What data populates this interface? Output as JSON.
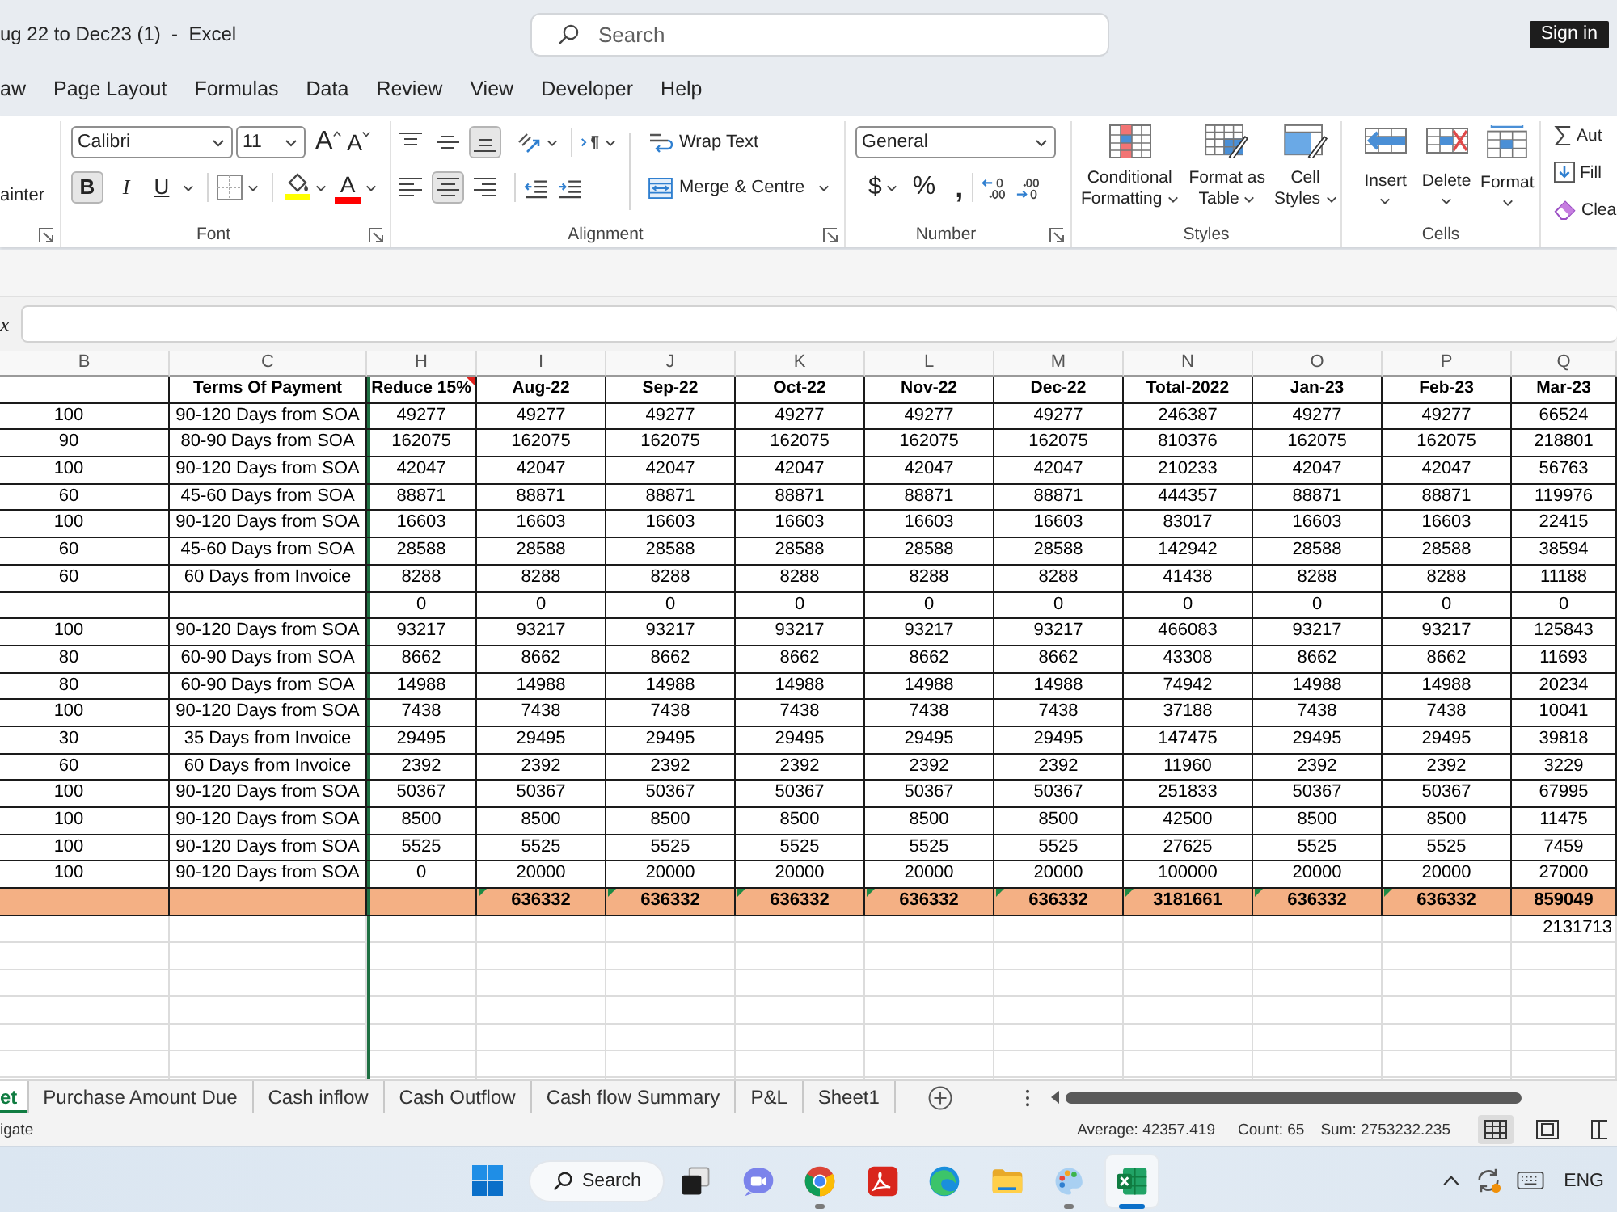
{
  "window": {
    "title": "ug 22 to Dec23 (1)  -  Excel",
    "search_placeholder": "Search",
    "sign_in": "Sign in"
  },
  "menu": [
    {
      "label": "aw",
      "selected": false
    },
    {
      "label": "Page Layout",
      "selected": false
    },
    {
      "label": "Formulas",
      "selected": false
    },
    {
      "label": "Data",
      "selected": false
    },
    {
      "label": "Review",
      "selected": false
    },
    {
      "label": "View",
      "selected": false
    },
    {
      "label": "Developer",
      "selected": false
    },
    {
      "label": "Help",
      "selected": false
    }
  ],
  "ribbon": {
    "clipboard": {
      "label": "ainter"
    },
    "font": {
      "title": "Font",
      "name": "Calibri",
      "size": "11",
      "grow": "A",
      "shrink": "A",
      "styles": [
        {
          "kind": "bold",
          "label": "B",
          "pressed": true
        },
        {
          "kind": "italic",
          "label": "I",
          "pressed": false
        },
        {
          "kind": "underline",
          "label": "U",
          "pressed": false
        }
      ],
      "color_buttons": [
        {
          "kind": "fill",
          "color": "#ffff00"
        },
        {
          "kind": "font",
          "letter": "A",
          "color": "#ff0000"
        }
      ]
    },
    "alignment": {
      "title": "Alignment",
      "top_row": [
        {
          "kind": "top",
          "pressed": false
        },
        {
          "kind": "middle",
          "pressed": false
        },
        {
          "kind": "bottom",
          "pressed": true
        }
      ],
      "bottom_row": [
        {
          "kind": "left",
          "pressed": false
        },
        {
          "kind": "center",
          "pressed": true
        },
        {
          "kind": "right",
          "pressed": false
        }
      ],
      "wrap_text": "Wrap Text",
      "merge": "Merge & Centre"
    },
    "number": {
      "title": "Number",
      "format": "General",
      "currency": "$",
      "percent": "%",
      "comma": ","
    },
    "styles": {
      "title": "Styles",
      "buttons": [
        {
          "kind": "conditional",
          "lines": [
            "Conditional",
            "Formatting"
          ]
        },
        {
          "kind": "table",
          "lines": [
            "Format as",
            "Table"
          ]
        },
        {
          "kind": "cell",
          "lines": [
            "Cell",
            "Styles"
          ]
        }
      ]
    },
    "cells": {
      "title": "Cells",
      "buttons": [
        {
          "kind": "insert",
          "label": "Insert"
        },
        {
          "kind": "delete",
          "label": "Delete"
        },
        {
          "kind": "format",
          "label": "Format"
        }
      ]
    },
    "editing": [
      {
        "kind": "sum",
        "label": "Aut"
      },
      {
        "kind": "fill",
        "label": "Fill"
      },
      {
        "kind": "clear",
        "label": "Clea"
      }
    ]
  },
  "formula_bar": {
    "function_label": "x"
  },
  "table": {
    "columns": [
      "B",
      "C",
      "H",
      "I",
      "J",
      "K",
      "L",
      "M",
      "N",
      "O",
      "P",
      "Q"
    ],
    "rows": [
      {
        "kind": "header",
        "cells": {
          "c": "Terms Of Payment",
          "h": "Reduce 15%",
          "i": "Aug-22",
          "j": "Sep-22",
          "k": "Oct-22",
          "l": "Nov-22",
          "m": "Dec-22",
          "n": "Total-2022",
          "o": "Jan-23",
          "p": "Feb-23",
          "q": "Mar-23"
        },
        "comment_marks": {
          "h": true
        }
      },
      {
        "kind": "data",
        "cells": {
          "b": "100",
          "c": "90-120 Days from SOA",
          "h": "49277",
          "i": "49277",
          "j": "49277",
          "k": "49277",
          "l": "49277",
          "m": "49277",
          "n": "246387",
          "o": "49277",
          "p": "49277",
          "q": "66524"
        }
      },
      {
        "kind": "data",
        "cells": {
          "b": "90",
          "c": "80-90 Days from SOA",
          "h": "162075",
          "i": "162075",
          "j": "162075",
          "k": "162075",
          "l": "162075",
          "m": "162075",
          "n": "810376",
          "o": "162075",
          "p": "162075",
          "q": "218801"
        }
      },
      {
        "kind": "data",
        "cells": {
          "b": "100",
          "c": "90-120 Days from SOA",
          "h": "42047",
          "i": "42047",
          "j": "42047",
          "k": "42047",
          "l": "42047",
          "m": "42047",
          "n": "210233",
          "o": "42047",
          "p": "42047",
          "q": "56763"
        }
      },
      {
        "kind": "data",
        "cells": {
          "b": "60",
          "c": "45-60 Days from SOA",
          "h": "88871",
          "i": "88871",
          "j": "88871",
          "k": "88871",
          "l": "88871",
          "m": "88871",
          "n": "444357",
          "o": "88871",
          "p": "88871",
          "q": "119976"
        }
      },
      {
        "kind": "data",
        "cells": {
          "b": "100",
          "c": "90-120 Days from SOA",
          "h": "16603",
          "i": "16603",
          "j": "16603",
          "k": "16603",
          "l": "16603",
          "m": "16603",
          "n": "83017",
          "o": "16603",
          "p": "16603",
          "q": "22415"
        }
      },
      {
        "kind": "data",
        "cells": {
          "b": "60",
          "c": "45-60 Days from SOA",
          "h": "28588",
          "i": "28588",
          "j": "28588",
          "k": "28588",
          "l": "28588",
          "m": "28588",
          "n": "142942",
          "o": "28588",
          "p": "28588",
          "q": "38594"
        }
      },
      {
        "kind": "data",
        "cells": {
          "b": "60",
          "c": "60 Days from Invoice",
          "h": "8288",
          "i": "8288",
          "j": "8288",
          "k": "8288",
          "l": "8288",
          "m": "8288",
          "n": "41438",
          "o": "8288",
          "p": "8288",
          "q": "11188"
        }
      },
      {
        "kind": "data",
        "cells": {
          "h": "0",
          "i": "0",
          "j": "0",
          "k": "0",
          "l": "0",
          "m": "0",
          "n": "0",
          "o": "0",
          "p": "0",
          "q": "0"
        }
      },
      {
        "kind": "data",
        "cells": {
          "b": "100",
          "c": "90-120 Days from SOA",
          "h": "93217",
          "i": "93217",
          "j": "93217",
          "k": "93217",
          "l": "93217",
          "m": "93217",
          "n": "466083",
          "o": "93217",
          "p": "93217",
          "q": "125843"
        }
      },
      {
        "kind": "data",
        "cells": {
          "b": "80",
          "c": "60-90 Days from SOA",
          "h": "8662",
          "i": "8662",
          "j": "8662",
          "k": "8662",
          "l": "8662",
          "m": "8662",
          "n": "43308",
          "o": "8662",
          "p": "8662",
          "q": "11693"
        }
      },
      {
        "kind": "data",
        "cells": {
          "b": "80",
          "c": "60-90 Days from SOA",
          "h": "14988",
          "i": "14988",
          "j": "14988",
          "k": "14988",
          "l": "14988",
          "m": "14988",
          "n": "74942",
          "o": "14988",
          "p": "14988",
          "q": "20234"
        }
      },
      {
        "kind": "data",
        "cells": {
          "b": "100",
          "c": "90-120 Days from SOA",
          "h": "7438",
          "i": "7438",
          "j": "7438",
          "k": "7438",
          "l": "7438",
          "m": "7438",
          "n": "37188",
          "o": "7438",
          "p": "7438",
          "q": "10041"
        }
      },
      {
        "kind": "data",
        "cells": {
          "b": "30",
          "c": "35 Days from Invoice",
          "h": "29495",
          "i": "29495",
          "j": "29495",
          "k": "29495",
          "l": "29495",
          "m": "29495",
          "n": "147475",
          "o": "29495",
          "p": "29495",
          "q": "39818"
        }
      },
      {
        "kind": "data",
        "cells": {
          "b": "60",
          "c": "60 Days from Invoice",
          "h": "2392",
          "i": "2392",
          "j": "2392",
          "k": "2392",
          "l": "2392",
          "m": "2392",
          "n": "11960",
          "o": "2392",
          "p": "2392",
          "q": "3229"
        }
      },
      {
        "kind": "data",
        "cells": {
          "b": "100",
          "c": "90-120 Days from SOA",
          "h": "50367",
          "i": "50367",
          "j": "50367",
          "k": "50367",
          "l": "50367",
          "m": "50367",
          "n": "251833",
          "o": "50367",
          "p": "50367",
          "q": "67995"
        }
      },
      {
        "kind": "data",
        "cells": {
          "b": "100",
          "c": "90-120 Days from SOA",
          "h": "8500",
          "i": "8500",
          "j": "8500",
          "k": "8500",
          "l": "8500",
          "m": "8500",
          "n": "42500",
          "o": "8500",
          "p": "8500",
          "q": "11475"
        }
      },
      {
        "kind": "data",
        "cells": {
          "b": "100",
          "c": "90-120 Days from SOA",
          "h": "5525",
          "i": "5525",
          "j": "5525",
          "k": "5525",
          "l": "5525",
          "m": "5525",
          "n": "27625",
          "o": "5525",
          "p": "5525",
          "q": "7459"
        }
      },
      {
        "kind": "data",
        "cells": {
          "b": "100",
          "c": "90-120 Days from SOA",
          "h": "0",
          "i": "20000",
          "j": "20000",
          "k": "20000",
          "l": "20000",
          "m": "20000",
          "n": "100000",
          "o": "20000",
          "p": "20000",
          "q": "27000"
        }
      },
      {
        "kind": "total",
        "cells": {
          "i": "636332",
          "j": "636332",
          "k": "636332",
          "l": "636332",
          "m": "636332",
          "n": "3181661",
          "o": "636332",
          "p": "636332",
          "q": "859049"
        },
        "error_flags": {
          "i": true,
          "j": true,
          "k": true,
          "l": true,
          "m": true,
          "n": true,
          "o": true,
          "p": true,
          "q": false
        }
      },
      {
        "kind": "plain",
        "cells": {
          "q": "2131713"
        }
      }
    ]
  },
  "sheet_tabs": [
    {
      "label": "et",
      "selected": true
    },
    {
      "label": "Purchase Amount Due",
      "selected": false
    },
    {
      "label": "Cash inflow",
      "selected": false
    },
    {
      "label": "Cash Outflow",
      "selected": false
    },
    {
      "label": "Cash flow Summary",
      "selected": false
    },
    {
      "label": "P&L",
      "selected": false
    },
    {
      "label": "Sheet1",
      "selected": false
    }
  ],
  "status_bar": {
    "mode": "igate",
    "average": "Average: 42357.419",
    "count": "Count: 65",
    "sum": "Sum: 2753232.235",
    "views": [
      {
        "kind": "normal",
        "selected": true
      },
      {
        "kind": "page-layout",
        "selected": false
      },
      {
        "kind": "page-break",
        "selected": false
      }
    ]
  },
  "taskbar": {
    "search": "Search",
    "apps": [
      {
        "kind": "tasks",
        "running": false,
        "active": false
      },
      {
        "kind": "chat",
        "running": false,
        "active": false
      },
      {
        "kind": "browser",
        "running": true,
        "active": false
      },
      {
        "kind": "pdf",
        "running": false,
        "active": false
      },
      {
        "kind": "browser-alt",
        "running": false,
        "active": false
      },
      {
        "kind": "folder",
        "running": false,
        "active": false
      },
      {
        "kind": "paint",
        "running": true,
        "active": false
      },
      {
        "kind": "sheet",
        "running": true,
        "active": true
      }
    ],
    "language": "ENG"
  }
}
